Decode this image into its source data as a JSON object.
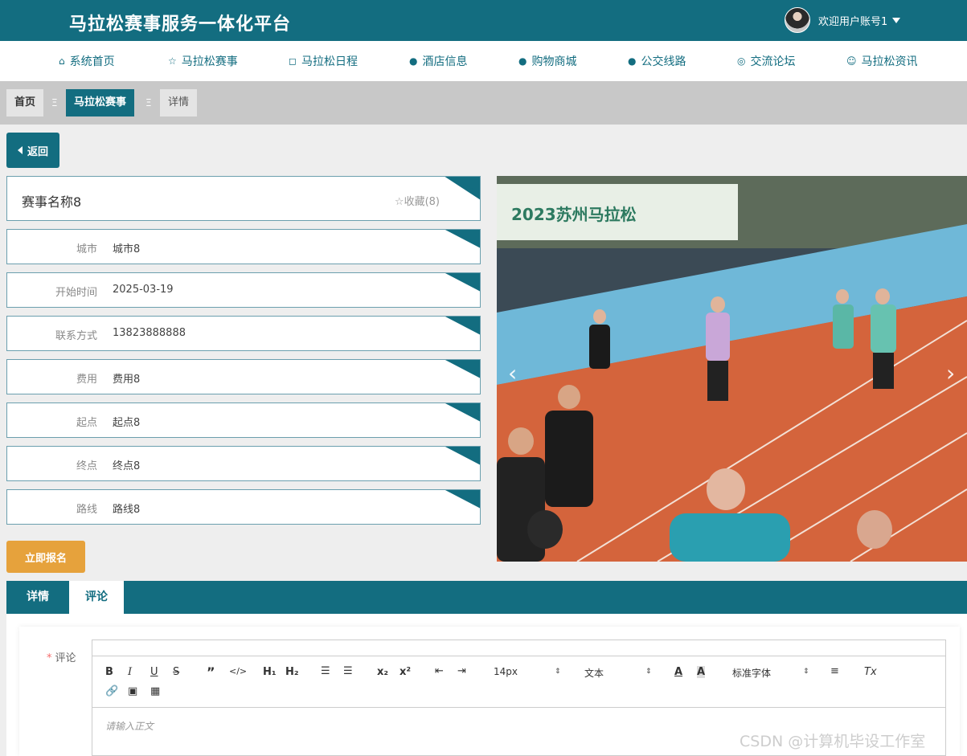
{
  "header": {
    "brand": "马拉松赛事服务一体化平台",
    "welcome": "欢迎用户账号1"
  },
  "nav": {
    "items": [
      {
        "label": "系统首页",
        "icon": "home-icon"
      },
      {
        "label": "马拉松赛事",
        "icon": "star-icon"
      },
      {
        "label": "马拉松日程",
        "icon": "bag-icon"
      },
      {
        "label": "酒店信息",
        "icon": "info-circle-icon"
      },
      {
        "label": "购物商城",
        "icon": "question-circle-icon"
      },
      {
        "label": "公交线路",
        "icon": "info-italic-icon"
      },
      {
        "label": "交流论坛",
        "icon": "target-icon"
      },
      {
        "label": "马拉松资讯",
        "icon": "smile-icon"
      }
    ]
  },
  "breadcrumb": {
    "home": "首页",
    "current": "马拉松赛事",
    "detail": "详情",
    "separator": "Ξ"
  },
  "back_label": "返回",
  "event": {
    "name": "赛事名称8",
    "favorite_label": "☆收藏(8)",
    "fields": [
      {
        "label": "城市",
        "value": "城市8"
      },
      {
        "label": "开始时间",
        "value": "2025-03-19"
      },
      {
        "label": "联系方式",
        "value": "13823888888"
      },
      {
        "label": "费用",
        "value": "费用8"
      },
      {
        "label": "起点",
        "value": "起点8"
      },
      {
        "label": "终点",
        "value": "终点8"
      },
      {
        "label": "路线",
        "value": "路线8"
      }
    ]
  },
  "signup_label": "立即报名",
  "carousel": {
    "banner_text": "2023苏州马拉松"
  },
  "tabs": [
    {
      "label": "详情"
    },
    {
      "label": "评论"
    }
  ],
  "comment": {
    "label": "评论",
    "required_mark": "*",
    "placeholder": "请输入正文",
    "font_size": "14px",
    "header_select": "文本",
    "font_family": "标准字体"
  },
  "watermark": "CSDN @计算机毕设工作室",
  "colors": {
    "primary": "#136d80",
    "accent": "#e6a23c"
  }
}
